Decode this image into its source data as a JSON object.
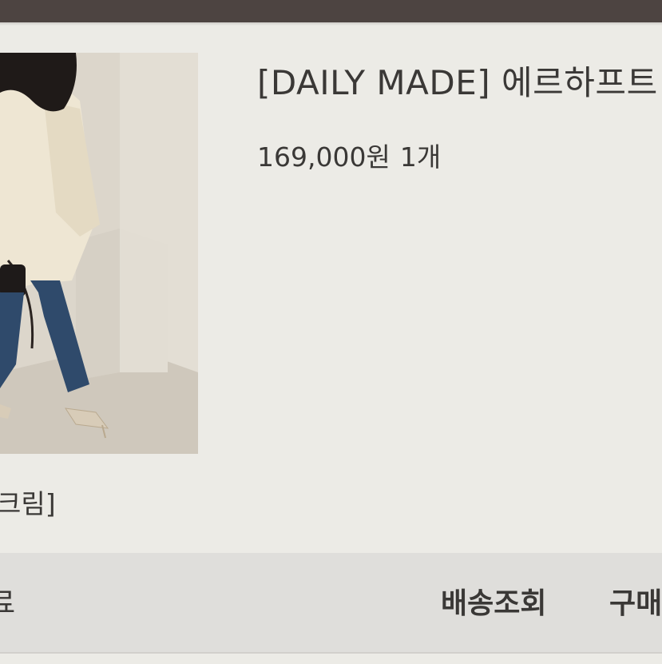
{
  "product": {
    "title": "[DAILY MADE] 에르하프트",
    "price": "169,000원",
    "quantity": "1개",
    "option": "크림]",
    "image": "product-photo"
  },
  "actions": {
    "left_label": "료",
    "track_label": "배송조회",
    "buy_label": "구매"
  },
  "colors": {
    "top_bar": "#4d4441",
    "background": "#ecebe6",
    "action_bar": "#dfdedb",
    "text": "#3a3836"
  }
}
